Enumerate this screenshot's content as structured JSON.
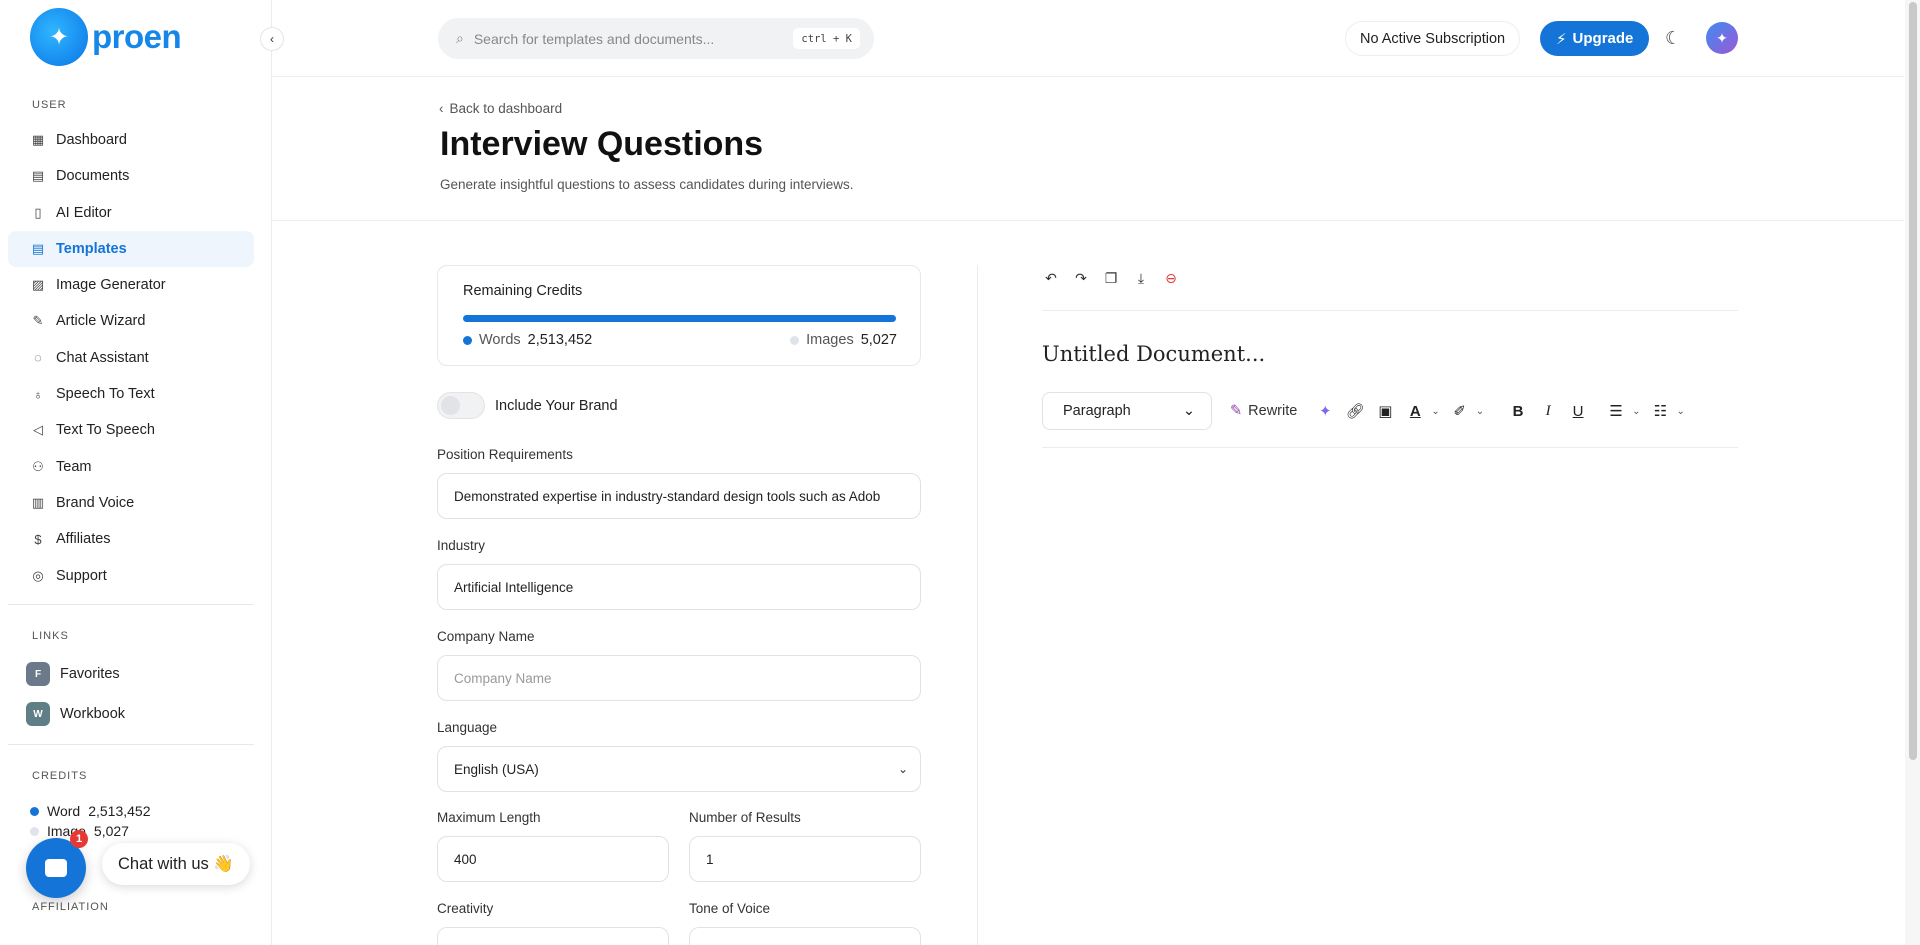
{
  "brand": {
    "name": "proen"
  },
  "sidebar": {
    "user_label": "USER",
    "items": [
      {
        "label": "Dashboard",
        "icon": "grid-icon"
      },
      {
        "label": "Documents",
        "icon": "archive-icon"
      },
      {
        "label": "AI Editor",
        "icon": "book-icon"
      },
      {
        "label": "Templates",
        "icon": "file-text-icon",
        "active": true
      },
      {
        "label": "Image Generator",
        "icon": "image-icon"
      },
      {
        "label": "Article Wizard",
        "icon": "file-edit-icon"
      },
      {
        "label": "Chat Assistant",
        "icon": "message-icon"
      },
      {
        "label": "Speech To Text",
        "icon": "mic-icon"
      },
      {
        "label": "Text To Speech",
        "icon": "speaker-icon"
      },
      {
        "label": "Team",
        "icon": "user-plus-icon"
      },
      {
        "label": "Brand Voice",
        "icon": "layout-icon"
      },
      {
        "label": "Affiliates",
        "icon": "dollar-icon"
      },
      {
        "label": "Support",
        "icon": "lifebuoy-icon"
      }
    ],
    "links_label": "LINKS",
    "links": [
      {
        "badge": "F",
        "label": "Favorites",
        "color": "#6b7a8a"
      },
      {
        "badge": "W",
        "label": "Workbook",
        "color": "#5f7e86"
      }
    ],
    "credits_label": "CREDITS",
    "credits": [
      {
        "label": "Word",
        "value": "2,513,452",
        "color": "#1474d8"
      },
      {
        "label": "Image",
        "value": "5,027",
        "color": "#dfe3ea"
      }
    ],
    "affiliation_label": "AFFILIATION"
  },
  "chat": {
    "badge": "1",
    "label": "Chat with us 👋"
  },
  "topbar": {
    "search_placeholder": "Search for templates and documents...",
    "shortcut": "ctrl + K",
    "subscription": "No Active Subscription",
    "upgrade": "Upgrade"
  },
  "page": {
    "back": "Back to dashboard",
    "title": "Interview Questions",
    "subtitle": "Generate insightful questions to assess candidates during interviews."
  },
  "credits_card": {
    "title": "Remaining Credits",
    "words_label": "Words",
    "words_value": "2,513,452",
    "images_label": "Images",
    "images_value": "5,027",
    "accent": "#1474d8"
  },
  "form": {
    "brand_toggle": "Include Your Brand",
    "position_label": "Position Requirements",
    "position_value": "Demonstrated expertise in industry-standard design tools such as Adob",
    "industry_label": "Industry",
    "industry_value": "Artificial Intelligence",
    "company_label": "Company Name",
    "company_placeholder": "Company Name",
    "language_label": "Language",
    "language_value": "English (USA)",
    "max_length_label": "Maximum Length",
    "max_length_value": "400",
    "results_label": "Number of Results",
    "results_value": "1",
    "creativity_label": "Creativity",
    "tone_label": "Tone of Voice"
  },
  "editor": {
    "doc_title": "Untitled Document...",
    "block_type": "Paragraph",
    "rewrite": "Rewrite"
  }
}
